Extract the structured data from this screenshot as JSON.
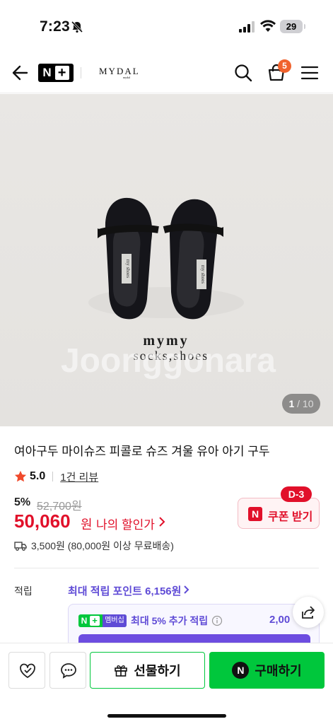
{
  "status_bar": {
    "time": "7:23",
    "battery": "29"
  },
  "header": {
    "store_name": "MYDAL",
    "store_sub": "mydal",
    "cart_count": "5"
  },
  "image": {
    "watermark": "Joonggonara",
    "photo_text_line1": "mymy",
    "photo_text_line2": "socks,shoes",
    "label_text": "my shoes",
    "counter_current": "1",
    "counter_total": "/ 10"
  },
  "product": {
    "title": "여아구두 마이슈즈 피콜로 슈즈 겨울 유아 아기 구두",
    "rating": "5.0",
    "review_link": "1건 리뷰",
    "discount_rate": "5%",
    "original_price": "52,700원",
    "sale_price": "50,060",
    "sale_unit": "원",
    "my_discount": "나의 할인가",
    "coupon_label": "쿠폰 받기",
    "coupon_n": "N",
    "dday": "D-3",
    "shipping": "3,500원 (80,000원 이상 무료배송)"
  },
  "points": {
    "label": "적립",
    "max_points": "최대 적립 포인트 6,156원",
    "membership_n": "N",
    "membership_plus": "+",
    "membership_tag": "멤버십",
    "membership_text": "최대 5% 추가 적립",
    "membership_points": "2,00"
  },
  "bottom_bar": {
    "gift_label": "선물하기",
    "buy_label": "구매하기",
    "buy_n": "N"
  },
  "colors": {
    "accent_red": "#e1102a",
    "naver_green": "#00c73c",
    "membership_purple": "#5f4bd6",
    "cart_badge": "#f0622d"
  }
}
